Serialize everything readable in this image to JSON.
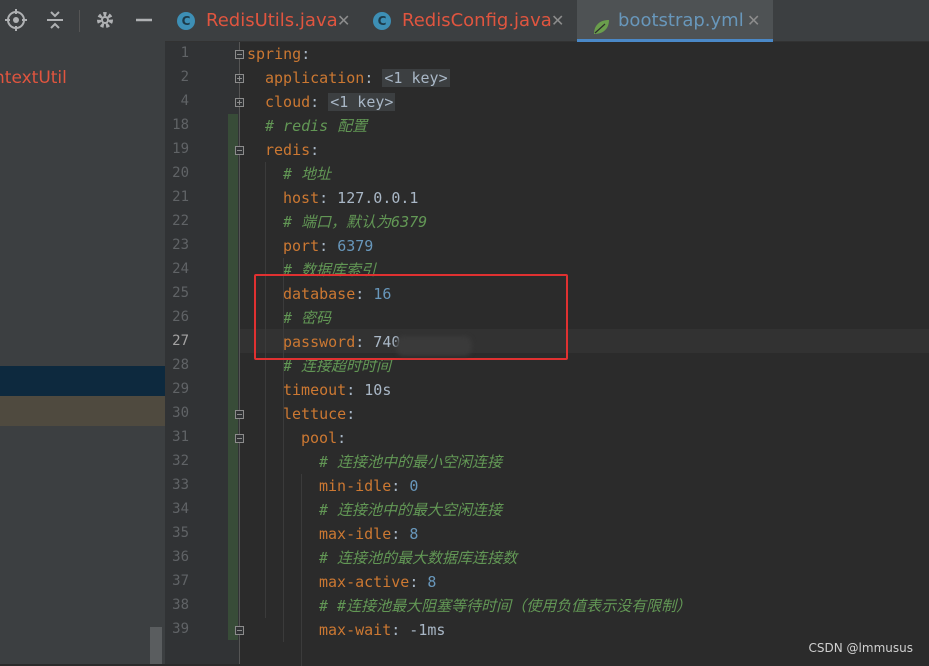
{
  "toolbar": {
    "icons": [
      "crosshair-icon",
      "collapse-icon",
      "gear-icon",
      "minimize-icon"
    ]
  },
  "sidebar": {
    "item_label": "ntextUtil"
  },
  "tabs": [
    {
      "label": "RedisUtils.java",
      "icon": "java-class-icon",
      "color": "#e0553f",
      "active": false
    },
    {
      "label": "RedisConfig.java",
      "icon": "java-class-icon",
      "color": "#e0553f",
      "active": false
    },
    {
      "label": "bootstrap.yml",
      "icon": "spring-leaf-icon",
      "color": "#6897bb",
      "active": true
    }
  ],
  "editor": {
    "current_line": "27",
    "lines": [
      {
        "n": "1",
        "parts": [
          [
            "k",
            "spring"
          ],
          [
            "v",
            ":"
          ]
        ]
      },
      {
        "n": "2",
        "parts": [
          [
            "k",
            "application"
          ],
          [
            "v",
            ": "
          ],
          [
            "fk",
            "<1 key>"
          ]
        ]
      },
      {
        "n": "4",
        "parts": [
          [
            "k",
            "cloud"
          ],
          [
            "v",
            ": "
          ],
          [
            "fk",
            "<1 key>"
          ]
        ]
      },
      {
        "n": "18",
        "parts": [
          [
            "c",
            "# redis 配置"
          ]
        ]
      },
      {
        "n": "19",
        "parts": [
          [
            "k",
            "redis"
          ],
          [
            "v",
            ":"
          ]
        ]
      },
      {
        "n": "20",
        "parts": [
          [
            "c",
            "# 地址"
          ]
        ]
      },
      {
        "n": "21",
        "parts": [
          [
            "k",
            "host"
          ],
          [
            "v",
            ": 127.0.0.1"
          ]
        ]
      },
      {
        "n": "22",
        "parts": [
          [
            "c",
            "# 端口，默认为6379"
          ]
        ]
      },
      {
        "n": "23",
        "parts": [
          [
            "k",
            "port"
          ],
          [
            "v",
            ": "
          ],
          [
            "n",
            "6379"
          ]
        ]
      },
      {
        "n": "24",
        "parts": [
          [
            "c",
            "# 数据库索引"
          ]
        ]
      },
      {
        "n": "25",
        "parts": [
          [
            "k",
            "database"
          ],
          [
            "v",
            ": "
          ],
          [
            "n",
            "16"
          ]
        ]
      },
      {
        "n": "26",
        "parts": [
          [
            "c",
            "# 密码"
          ]
        ]
      },
      {
        "n": "27",
        "parts": [
          [
            "k",
            "password"
          ],
          [
            "v",
            ": 740"
          ]
        ]
      },
      {
        "n": "28",
        "parts": [
          [
            "c",
            "# 连接超时时间"
          ]
        ]
      },
      {
        "n": "29",
        "parts": [
          [
            "k",
            "timeout"
          ],
          [
            "v",
            ": 10s"
          ]
        ]
      },
      {
        "n": "30",
        "parts": [
          [
            "k",
            "lettuce"
          ],
          [
            "v",
            ":"
          ]
        ]
      },
      {
        "n": "31",
        "parts": [
          [
            "k",
            "pool"
          ],
          [
            "v",
            ":"
          ]
        ]
      },
      {
        "n": "32",
        "parts": [
          [
            "c",
            "# 连接池中的最小空闲连接"
          ]
        ]
      },
      {
        "n": "33",
        "parts": [
          [
            "k",
            "min-idle"
          ],
          [
            "v",
            ": "
          ],
          [
            "n",
            "0"
          ]
        ]
      },
      {
        "n": "34",
        "parts": [
          [
            "c",
            "# 连接池中的最大空闲连接"
          ]
        ]
      },
      {
        "n": "35",
        "parts": [
          [
            "k",
            "max-idle"
          ],
          [
            "v",
            ": "
          ],
          [
            "n",
            "8"
          ]
        ]
      },
      {
        "n": "36",
        "parts": [
          [
            "c",
            "# 连接池的最大数据库连接数"
          ]
        ]
      },
      {
        "n": "37",
        "parts": [
          [
            "k",
            "max-active"
          ],
          [
            "v",
            ": "
          ],
          [
            "n",
            "8"
          ]
        ]
      },
      {
        "n": "38",
        "parts": [
          [
            "c",
            "# #连接池最大阻塞等待时间（使用负值表示没有限制）"
          ]
        ]
      },
      {
        "n": "39",
        "parts": [
          [
            "k",
            "max-wait"
          ],
          [
            "v",
            ": -1ms"
          ]
        ]
      }
    ]
  },
  "watermark": "CSDN @lmmusus",
  "colors": {
    "key": "#cc7832",
    "comment": "#629755",
    "number": "#6897bb",
    "highlight_box": "#e03131"
  }
}
